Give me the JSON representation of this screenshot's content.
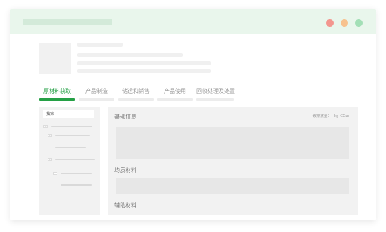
{
  "window": {
    "controls": [
      {
        "name": "close",
        "color": "#f3968e"
      },
      {
        "name": "minimize",
        "color": "#f7c28e"
      },
      {
        "name": "maximize",
        "color": "#a3dfb6"
      }
    ]
  },
  "tabs": [
    {
      "label": "原材料获取",
      "active": true
    },
    {
      "label": "产品制造",
      "active": false
    },
    {
      "label": "储运和销售",
      "active": false
    },
    {
      "label": "产品使用",
      "active": false
    },
    {
      "label": "回收处理及处置",
      "active": false
    }
  ],
  "sidebar": {
    "search_label": "搜索",
    "tree_toggle_symbol": "−"
  },
  "main": {
    "section_basic": "基础信息",
    "emission_label": "碳排放量：--kg CO₂e",
    "section_uniform": "均质材料",
    "section_auxiliary": "辅助材料"
  },
  "colors": {
    "accent": "#25a046",
    "titlebar": "#e9f6ec"
  }
}
